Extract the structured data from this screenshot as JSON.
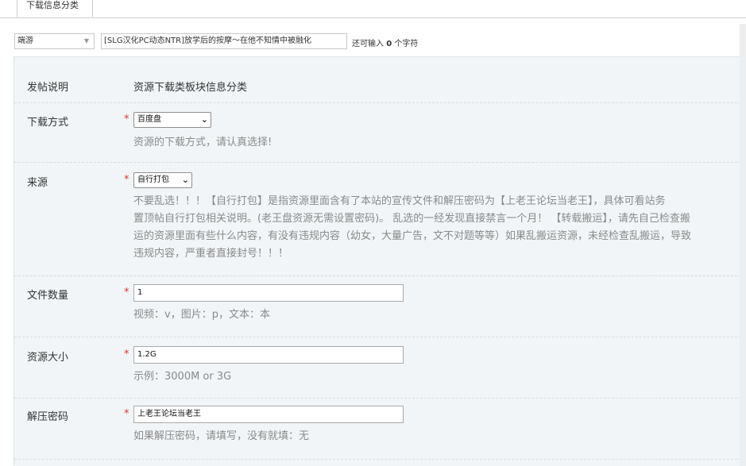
{
  "tabs": {
    "active": "下载信息分类"
  },
  "title_row": {
    "type_select": "端游",
    "subject_value": "[SLG汉化PC动态NTR]放学后的按摩～在他不知情中被融化",
    "remaining_prefix": "还可输入",
    "remaining_count": "0",
    "remaining_suffix": "个字符"
  },
  "form": {
    "intro": {
      "label": "发帖说明",
      "value": "资源下载类板块信息分类"
    },
    "download": {
      "label": "下载方式",
      "required": "*",
      "selected": "百度盘",
      "hint": "资源的下载方式，请认真选择!"
    },
    "source": {
      "label": "来源",
      "required": "*",
      "selected": "自行打包",
      "hint_lines": [
        "不要乱选！！！【自行打包】是指资源里面含有了本站的宣传文件和解压密码为【上老王论坛当老王】，具体可看站务",
        "置顶帖自行打包相关说明。(老王盘资源无需设置密码)。 乱选的一经发现直接禁言一个月！ 【转载搬运】，请先自己检查搬",
        "运的资源里面有些什么内容，有没有违规内容（幼女，大量广告，文不对题等等）如果乱搬运资源，未经检查乱搬运，导致",
        "违规内容，严重者直接封号！！！"
      ]
    },
    "file_count": {
      "label": "文件数量",
      "required": "*",
      "value": "1",
      "hint": "视频：v，图片：p，文本：本"
    },
    "size": {
      "label": "资源大小",
      "required": "*",
      "value": "1.2G",
      "hint": "示例：3000M or 3G"
    },
    "password": {
      "label": "解压密码",
      "required": "*",
      "value": "上老王论坛当老王",
      "hint": "如果解压密码，请填写，没有就填：无"
    }
  }
}
